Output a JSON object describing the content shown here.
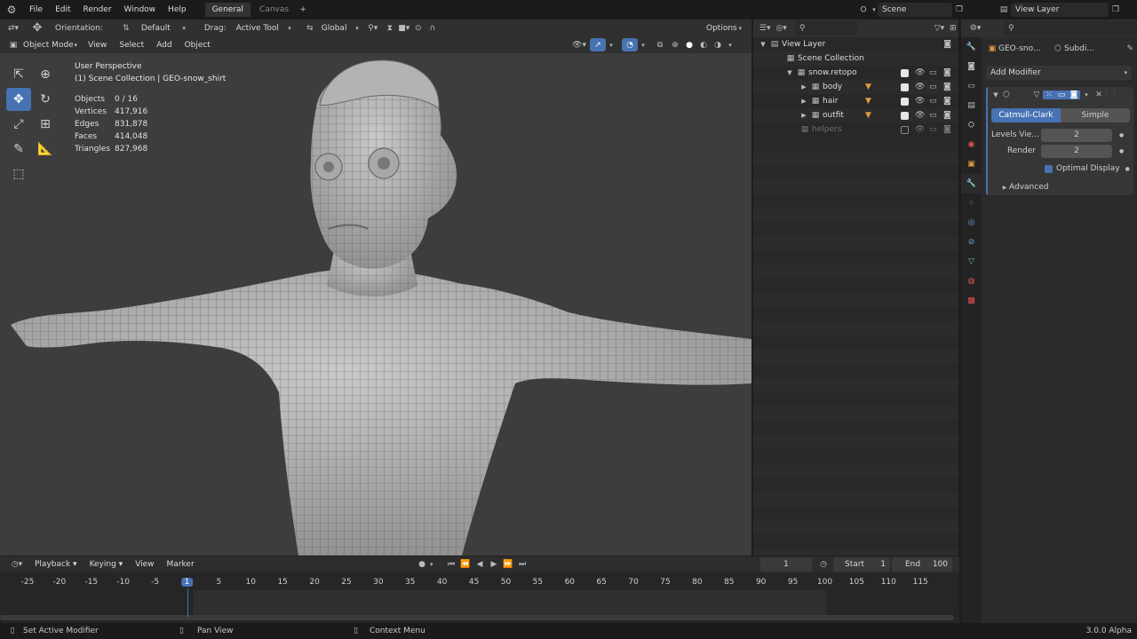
{
  "menubar": {
    "items": [
      "File",
      "Edit",
      "Render",
      "Window",
      "Help"
    ],
    "tabs": [
      {
        "label": "General",
        "active": true
      },
      {
        "label": "Canvas",
        "active": false
      }
    ],
    "scene": "Scene",
    "view_layer": "View Layer"
  },
  "viewport_header": {
    "orientation_label": "Orientation:",
    "orientation_value": "Default",
    "drag_label": "Drag:",
    "drag_value": "Active Tool",
    "transform_value": "Global",
    "options_label": "Options",
    "mode": "Object Mode",
    "menus": [
      "View",
      "Select",
      "Add",
      "Object"
    ]
  },
  "viewport_overlay": {
    "perspective": "User Perspective",
    "collection": "(1) Scene Collection | GEO-snow_shirt",
    "stats": [
      {
        "label": "Objects",
        "value": "0 / 16"
      },
      {
        "label": "Vertices",
        "value": "417,916"
      },
      {
        "label": "Edges",
        "value": "831,878"
      },
      {
        "label": "Faces",
        "value": "414,048"
      },
      {
        "label": "Triangles",
        "value": "827,968"
      }
    ]
  },
  "outliner": {
    "rows": [
      {
        "label": "View Layer",
        "indent": 0
      },
      {
        "label": "Scene Collection",
        "indent": 1
      },
      {
        "label": "snow.retopo",
        "indent": 2
      },
      {
        "label": "body",
        "indent": 3
      },
      {
        "label": "hair",
        "indent": 3
      },
      {
        "label": "outfit",
        "indent": 3
      },
      {
        "label": "helpers",
        "indent": 2
      }
    ]
  },
  "properties": {
    "object_name": "GEO-sno...",
    "modifier_name": "Subdi...",
    "add_modifier": "Add Modifier",
    "subdiv_types": [
      "Catmull-Clark",
      "Simple"
    ],
    "levels_viewport_label": "Levels Vie...",
    "levels_viewport_value": "2",
    "render_label": "Render",
    "render_value": "2",
    "optimal_display": "Optimal Display",
    "advanced": "Advanced"
  },
  "timeline": {
    "menus": [
      "Playback",
      "Keying",
      "View",
      "Marker"
    ],
    "current_frame": "1",
    "start_label": "Start",
    "start_value": "1",
    "end_label": "End",
    "end_value": "100",
    "ticks": [
      "-25",
      "-20",
      "-15",
      "-10",
      "-5",
      "1",
      "5",
      "10",
      "15",
      "20",
      "25",
      "30",
      "35",
      "40",
      "45",
      "50",
      "55",
      "60",
      "65",
      "70",
      "75",
      "80",
      "85",
      "90",
      "95",
      "100",
      "105",
      "110",
      "115"
    ]
  },
  "statusbar": {
    "left": "Set Active Modifier",
    "middle": "Pan View",
    "right_hint": "Context Menu",
    "version": "3.0.0 Alpha"
  },
  "colors": {
    "accent": "#4772b3",
    "viewport_bg": "#3d3d3d",
    "panel_bg": "#2b2b2b"
  }
}
